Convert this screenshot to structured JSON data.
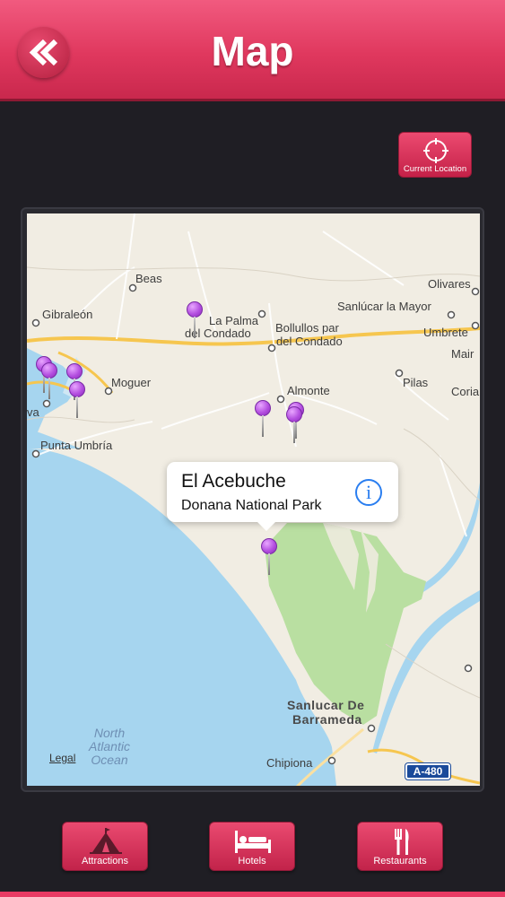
{
  "header": {
    "title": "Map",
    "back_icon": "double-chevron-left-icon"
  },
  "current_location": {
    "label": "Current Location",
    "icon": "crosshair-icon"
  },
  "map": {
    "places": [
      {
        "id": "beas",
        "name": "Beas"
      },
      {
        "id": "gibraleon",
        "name": "Gibraleón"
      },
      {
        "id": "olivares",
        "name": "Olivares"
      },
      {
        "id": "sanlucar-mayor",
        "name": "Sanlúcar la Mayor"
      },
      {
        "id": "la-palma-1",
        "name": "La Palma"
      },
      {
        "id": "la-palma-2",
        "name": "del Condado"
      },
      {
        "id": "bollullos-1",
        "name": "Bollullos par"
      },
      {
        "id": "bollullos-2",
        "name": "del Condado"
      },
      {
        "id": "umbrete",
        "name": "Umbrete"
      },
      {
        "id": "mair",
        "name": "Mair"
      },
      {
        "id": "moguer",
        "name": "Moguer"
      },
      {
        "id": "almonte",
        "name": "Almonte"
      },
      {
        "id": "pilas",
        "name": "Pilas"
      },
      {
        "id": "coria",
        "name": "Coria"
      },
      {
        "id": "huelva",
        "name": "va"
      },
      {
        "id": "punta-umbria",
        "name": "Punta Umbría"
      },
      {
        "id": "chipiona",
        "name": "Chipiona"
      }
    ],
    "sanlucar_barrameda": [
      "Sanlucar De",
      "Barrameda"
    ],
    "ocean": [
      "North",
      "Atlantic",
      "Ocean"
    ],
    "legal": "Legal",
    "road_shield": "A-480",
    "callout": {
      "title": "El Acebuche",
      "subtitle": "Donana National Park",
      "icon": "info-icon"
    },
    "colors": {
      "land": "#f1ede3",
      "water": "#a6d5ef",
      "park": "#b9dfa1",
      "road": "#f6c64f",
      "pin": "#b44fe0"
    }
  },
  "tabs": [
    {
      "label": "Attractions",
      "icon": "tent-icon"
    },
    {
      "label": "Hotels",
      "icon": "bed-icon"
    },
    {
      "label": "Restaurants",
      "icon": "fork-knife-icon"
    }
  ],
  "theme": {
    "accent": "#e0385e",
    "background": "#1f1e24"
  }
}
